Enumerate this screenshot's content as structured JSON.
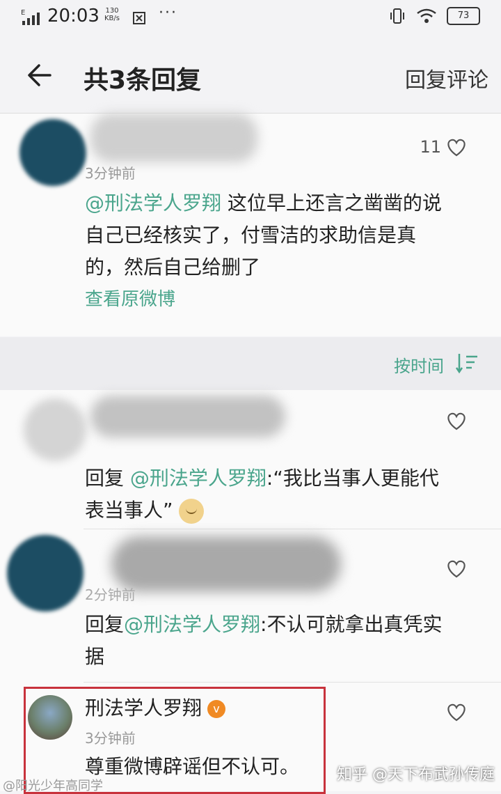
{
  "status_bar": {
    "time": "20:03",
    "speed_value": "130",
    "speed_unit": "KB/s",
    "dots": "···",
    "battery": "73"
  },
  "app_bar": {
    "title": "共3条回复",
    "reply_comment": "回复评论"
  },
  "main_comment": {
    "likes": "11",
    "time": "3分钟前",
    "mention": "@刑法学人罗翔",
    "text_line1": " 这位早上还言之凿凿的说",
    "text_line2": "自己已经核实了，付雪洁的求助信是真",
    "text_line3": "的，然后自己给删了",
    "view_original": "查看原微博"
  },
  "sort": {
    "label": "按时间"
  },
  "replies": [
    {
      "reply_prefix": "回复 ",
      "mention": "@刑法学人罗翔",
      "text_line1": ":“我比当事人更能代",
      "text_line2": "表当事人”"
    },
    {
      "time": "2分钟前",
      "reply_prefix": "回复",
      "mention": "@刑法学人罗翔",
      "text_line1": ":不认可就拿出真凭实",
      "text_line2": "据"
    },
    {
      "username": "刑法学人罗翔",
      "badge": "v",
      "time": "3分钟前",
      "text": "尊重微博辟谣但不认可。"
    }
  ],
  "watermarks": {
    "left": "@阳光少年高同学",
    "right": "知乎 @天下布武孙传庭"
  },
  "colors": {
    "mention": "#4aa58c",
    "highlight_border": "#c8323c",
    "badge": "#f08a24"
  }
}
